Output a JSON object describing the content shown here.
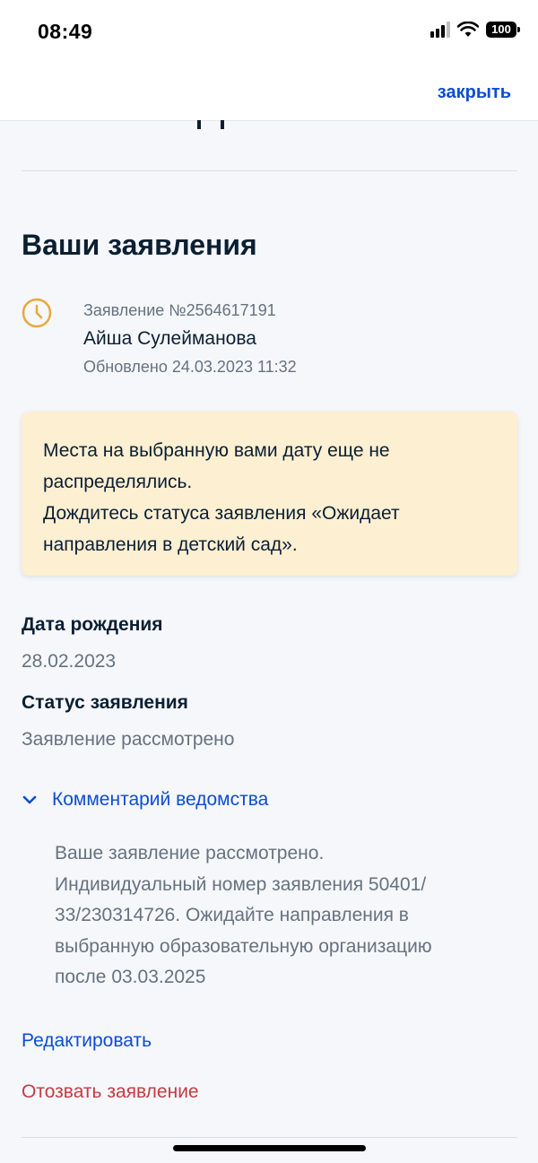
{
  "status_bar": {
    "time": "08:49",
    "battery": "100"
  },
  "nav": {
    "close_label": "закрыть"
  },
  "section": {
    "title": "Ваши заявления"
  },
  "application": {
    "number": "Заявление №2564617191",
    "name": "Айша Сулейманова",
    "updated": "Обновлено 24.03.2023 11:32"
  },
  "notice": {
    "line1": "Места на выбранную вами дату еще не",
    "line2": "распределялись.",
    "line3": "Дождитесь статуса заявления «Ожидает",
    "line4": "направления в детский сад»."
  },
  "details": {
    "birth_label": "Дата рождения",
    "birth_value": "28.02.2023",
    "status_label": "Статус заявления",
    "status_value": "Заявление рассмотрено"
  },
  "comment": {
    "toggle_label": "Комментарий ведомства",
    "lines": [
      "Ваше заявление рассмотрено.",
      "Индивидуальный номер заявления 50401/",
      "33/230314726. Ожидайте направления в",
      "выбранную образовательную организацию",
      "после 03.03.2025"
    ]
  },
  "actions": {
    "edit_label": "Редактировать",
    "withdraw_label": "Отозвать заявление"
  },
  "colors": {
    "link": "#0d4cd3",
    "danger": "#c63a42",
    "notice_bg": "#fcefd2",
    "clock_icon": "#e8a93a"
  },
  "icons": {
    "status": "clock-icon",
    "toggle": "chevron-down-icon"
  }
}
